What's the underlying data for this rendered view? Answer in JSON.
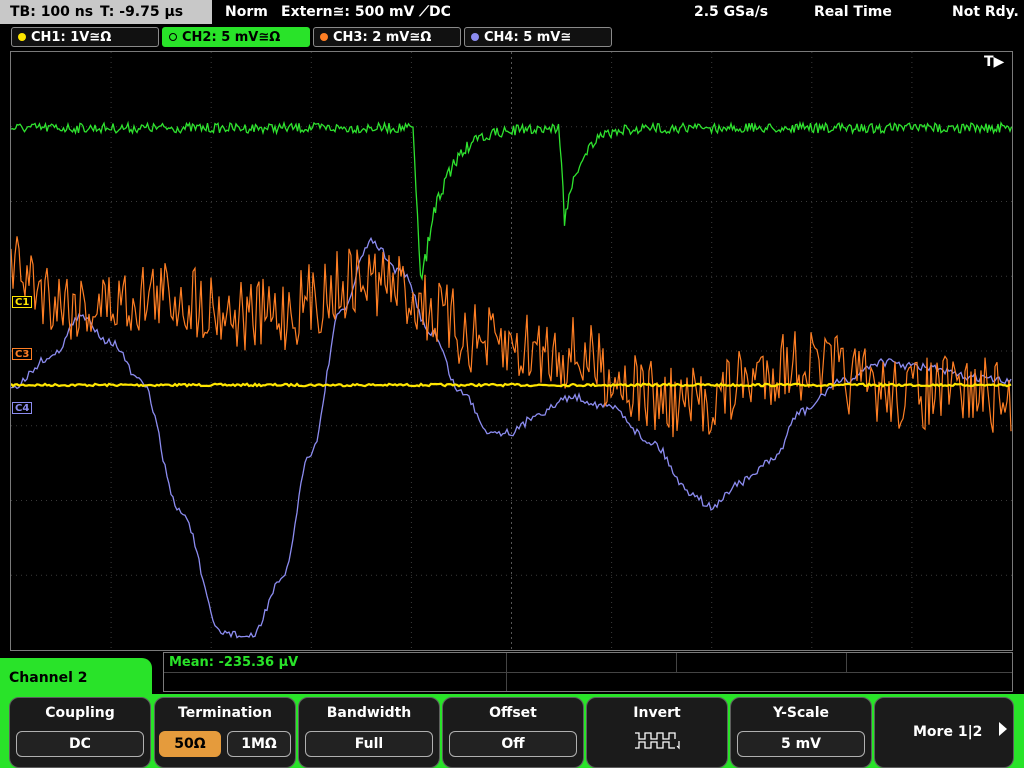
{
  "status": {
    "timebase": "TB: 100 ns",
    "trigger_time": "T: -9.75 µs",
    "mode": "Norm",
    "trigger": "Extern≅: 500 mV ⟋DC",
    "sample_rate": "2.5 GSa/s",
    "acq_mode": "Real Time",
    "state": "Not Rdy."
  },
  "channels": [
    {
      "label": "CH1: 1V≅Ω",
      "color": "#ffe600"
    },
    {
      "label": "CH2: 5 mV≅Ω",
      "color": "#2fe32f"
    },
    {
      "label": "CH3: 2 mV≅Ω",
      "color": "#ff7f24"
    },
    {
      "label": "CH4: 5 mV≅",
      "color": "#8c8cf0"
    }
  ],
  "markers": {
    "c1": "C1",
    "c3": "C3",
    "c4": "C4",
    "trigger_pos": "T▶"
  },
  "measurement": {
    "label": "Mean: -235.36 µV"
  },
  "menu": {
    "title": "Channel 2",
    "coupling": {
      "title": "Coupling",
      "value": "DC"
    },
    "termination": {
      "title": "Termination",
      "opt1": "50Ω",
      "opt2": "1MΩ"
    },
    "bandwidth": {
      "title": "Bandwidth",
      "value": "Full"
    },
    "offset": {
      "title": "Offset",
      "value": "Off"
    },
    "invert": {
      "title": "Invert"
    },
    "yscale": {
      "title": "Y-Scale",
      "value": "5 mV"
    },
    "more": {
      "label": "More 1|2"
    }
  }
}
